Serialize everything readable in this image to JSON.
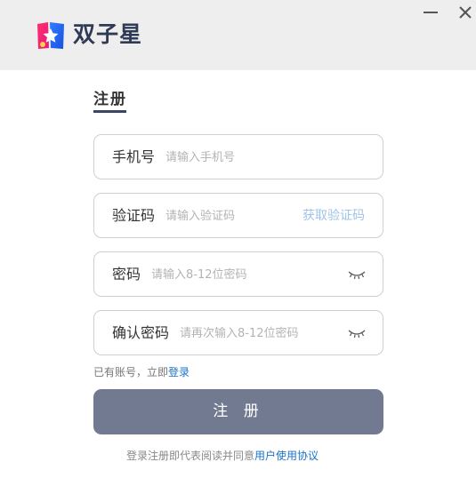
{
  "app": {
    "title": "双子星",
    "logo_icon": "star-logo-icon",
    "window_controls": [
      "minimize-icon",
      "close-icon"
    ]
  },
  "tab": {
    "label": "注册",
    "underline_color": "#3a4668"
  },
  "fields": {
    "phone": {
      "label": "手机号",
      "placeholder": "请输入手机号",
      "value": ""
    },
    "code": {
      "label": "验证码",
      "placeholder": "请输入验证码",
      "value": "",
      "action_label": "获取验证码"
    },
    "password": {
      "label": "密码",
      "placeholder": "请输入8-12位密码",
      "value": "",
      "icon": "eye-closed-icon"
    },
    "confirm": {
      "label": "确认密码",
      "placeholder": "请再次输入8-12位密码",
      "value": "",
      "icon": "eye-closed-icon"
    }
  },
  "login_prompt": {
    "text": "已有账号，立即",
    "link": "登录"
  },
  "submit": {
    "label": "注 册",
    "color": "#717a91"
  },
  "agreement": {
    "text": "登录注册即代表阅读并同意",
    "link": "用户使用协议"
  },
  "colors": {
    "link": "#1a73c9",
    "get_code": "#9fc4e8",
    "titlebar": "#eeeeee"
  }
}
